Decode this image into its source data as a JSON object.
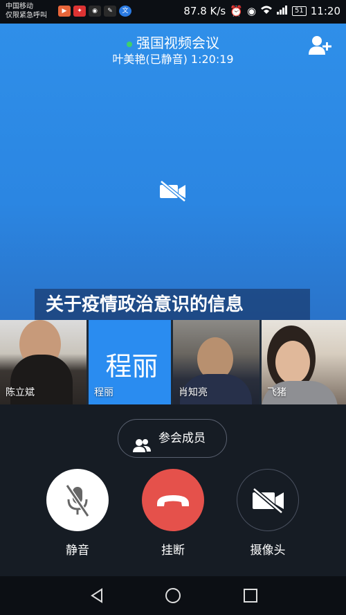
{
  "status_bar": {
    "carrier_line1": "中国移动",
    "carrier_line2": "仅限紧急呼叫",
    "network_speed": "87.8 K/s",
    "battery": "51",
    "time": "11:20"
  },
  "meeting": {
    "title": "强国视频会议",
    "speaker_status": "叶美艳(已静音) 1:20:19"
  },
  "headline": "关于疫情政治意识的信息",
  "participants": [
    {
      "name": "陈立斌"
    },
    {
      "name": "程丽",
      "avatar_text": "程丽"
    },
    {
      "name": "肖知亮"
    },
    {
      "name": "飞猪"
    }
  ],
  "controls": {
    "members_label": "参会成员",
    "mute_label": "静音",
    "hangup_label": "挂断",
    "camera_label": "摄像头"
  },
  "colors": {
    "video_bg": "#2f8fe9",
    "hangup": "#e5514b",
    "online_dot": "#3fd06a"
  },
  "icons": [
    "add-member-icon",
    "camera-off-icon",
    "members-icon",
    "mic-off-icon",
    "hangup-icon",
    "back-icon",
    "home-icon",
    "recents-icon"
  ]
}
